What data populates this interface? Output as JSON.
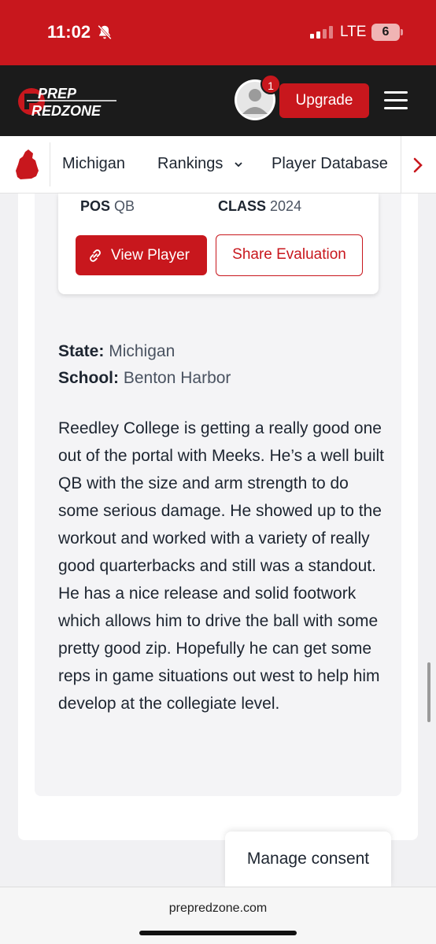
{
  "status_bar": {
    "time": "11:02",
    "network": "LTE",
    "battery": "6",
    "icons": [
      "bell-slash-icon",
      "signal-icon"
    ]
  },
  "header": {
    "logo_line1": "PREP",
    "logo_line2": "REDZONE",
    "notification_count": "1",
    "upgrade_label": "Upgrade",
    "icons": [
      "avatar-icon",
      "menu-icon"
    ]
  },
  "state_nav": {
    "items": [
      {
        "label": "Michigan"
      },
      {
        "label": "Rankings"
      },
      {
        "label": "Player Database"
      }
    ],
    "icons": [
      "michigan-state-icon",
      "chevron-down-icon",
      "chevron-right-icon"
    ]
  },
  "player": {
    "pos_label": "POS",
    "pos_value": "QB",
    "class_label": "CLASS",
    "class_value": "2024",
    "view_label": "View Player",
    "share_label": "Share Evaluation"
  },
  "meta": {
    "state_label": "State:",
    "state_value": "Michigan",
    "school_label": "School:",
    "school_value": "Benton Harbor"
  },
  "evaluation": {
    "text": "Reedley College is getting a really good one out of the portal with Meeks. He’s a well built QB with the size and arm strength to do some serious damage. He showed up to the workout and worked with a variety of really good quarterbacks and still was a standout. He has a nice release and solid footwork which allows him to drive the ball with some pretty good zip. Hopefully he can get some reps in game situations out west to help him develop at the collegiate level."
  },
  "consent": {
    "label": "Manage consent"
  },
  "browser": {
    "url": "prepredzone.com"
  },
  "colors": {
    "brand_red": "#c8171d",
    "header_dark": "#1b1b1b",
    "text": "#1d2530"
  }
}
